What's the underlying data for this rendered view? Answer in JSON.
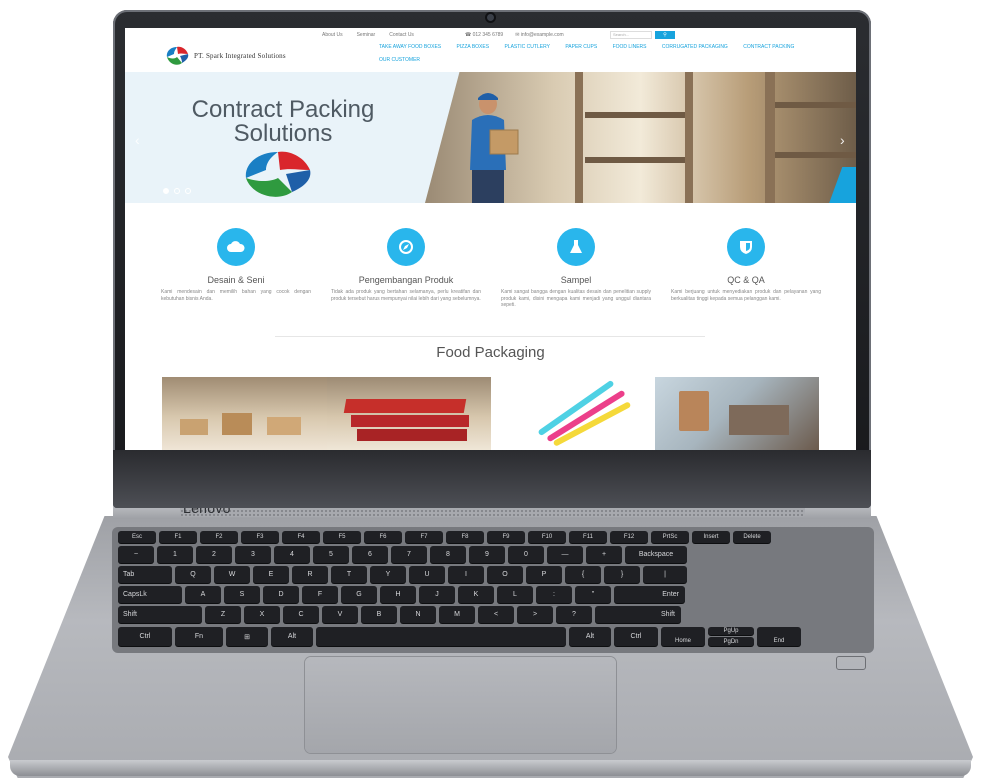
{
  "laptop": {
    "brand": "Lenovo"
  },
  "website": {
    "topbar": {
      "links": [
        "About Us",
        "Seminar",
        "Contact Us"
      ],
      "phone": "012 345 6789",
      "email": "info@example.com",
      "search_placeholder": "Search..."
    },
    "company": "PT. Spark Integrated Solutions",
    "nav": [
      "TAKE AWAY FOOD BOXES",
      "PIZZA BOXES",
      "PLASTIC CUTLERY",
      "PAPER CUPS",
      "FOOD LINERS",
      "CORRUGATED PACKAGING",
      "CONTRACT PACKING",
      "OUR CUSTOMER"
    ],
    "hero": {
      "title_line1": "Contract Packing",
      "title_line2": "Solutions"
    },
    "features": [
      {
        "title": "Desain & Seni",
        "text": "Kami mendesain dan memilih bahan yang cocok dengan kebutuhan bisnis Anda."
      },
      {
        "title": "Pengembangan Produk",
        "text": "Tidak ada produk yang bertahan selamanya, perlu kreatifan dan produk tersebut harus mempunyai nilai lebih dari yang sebelumnya."
      },
      {
        "title": "Sampel",
        "text": "Kami sangat bangga dengan kualitas desain dan penelitian supply produk kami, disini mengapa kami menjadi yang unggul diantara sepeti."
      },
      {
        "title": "QC & QA",
        "text": "Kami berjuang untuk menyediakan produk dan pelayanan yang berkualitas tinggi kepada semua pelanggan kami."
      }
    ],
    "section_title": "Food Packaging"
  },
  "keyboard": {
    "row0": [
      "Esc",
      "F1",
      "F2",
      "F3",
      "F4",
      "F5",
      "F6",
      "F7",
      "F8",
      "F9",
      "F10",
      "F11",
      "F12",
      "PrtSc",
      "Insert",
      "Delete"
    ],
    "row1": [
      "~",
      "1",
      "2",
      "3",
      "4",
      "5",
      "6",
      "7",
      "8",
      "9",
      "0",
      "—",
      "+",
      "Backspace"
    ],
    "row2": [
      "Tab",
      "Q",
      "W",
      "E",
      "R",
      "T",
      "Y",
      "U",
      "I",
      "O",
      "P",
      "{",
      "}",
      "|"
    ],
    "row3": [
      "CapsLk",
      "A",
      "S",
      "D",
      "F",
      "G",
      "H",
      "J",
      "K",
      "L",
      ":",
      "\"",
      "Enter"
    ],
    "row4": [
      "Shift",
      "Z",
      "X",
      "C",
      "V",
      "B",
      "N",
      "M",
      "<",
      ">",
      "?",
      "Shift"
    ],
    "row5": [
      "Ctrl",
      "Fn",
      "⊞",
      "Alt",
      "",
      "Alt",
      "Ctrl",
      "Home",
      "PgUp",
      "End"
    ],
    "pgdn": "PgDn"
  },
  "colors": {
    "accent": "#17a3dd",
    "icon_circle": "#29b6ec"
  }
}
